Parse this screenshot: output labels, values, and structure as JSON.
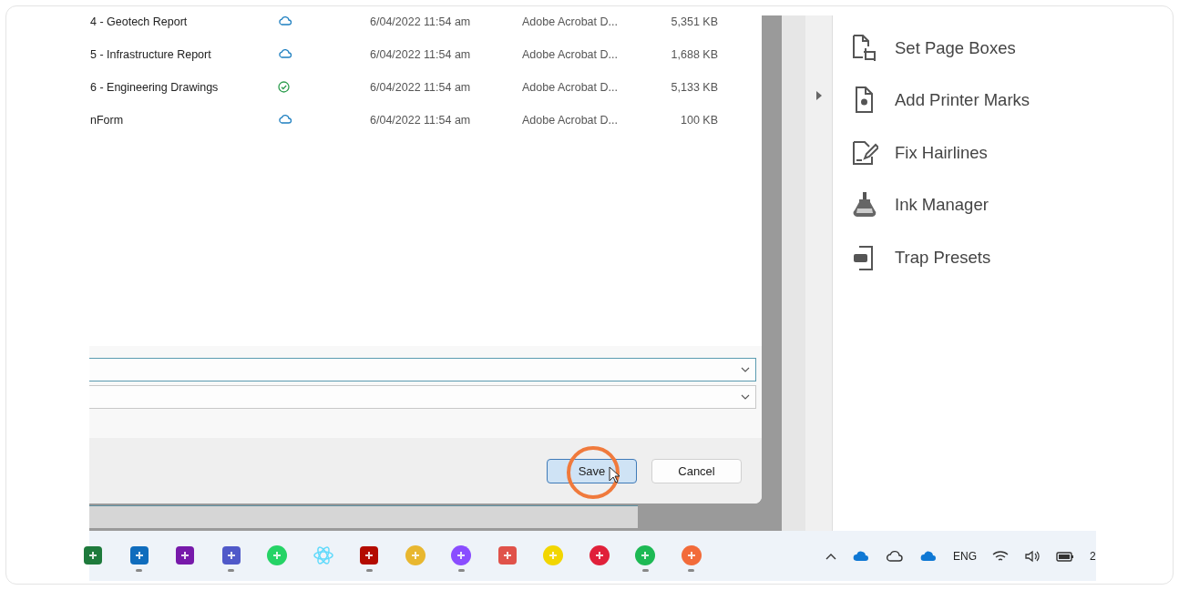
{
  "files": [
    {
      "name": "4 - Geotech Report",
      "synced": false,
      "modified": "6/04/2022 11:54 am",
      "type": "Adobe Acrobat D...",
      "size": "5,351 KB"
    },
    {
      "name": "5 - Infrastructure Report",
      "synced": false,
      "modified": "6/04/2022 11:54 am",
      "type": "Adobe Acrobat D...",
      "size": "1,688 KB"
    },
    {
      "name": "6 - Engineering Drawings",
      "synced": true,
      "modified": "6/04/2022 11:54 am",
      "type": "Adobe Acrobat D...",
      "size": "5,133 KB"
    },
    {
      "name": "nForm",
      "synced": false,
      "modified": "6/04/2022 11:54 am",
      "type": "Adobe Acrobat D...",
      "size": "100 KB"
    }
  ],
  "buttons": [
    {
      "label": "Save",
      "kind": "primary"
    },
    {
      "label": "Cancel",
      "kind": "secondary"
    }
  ],
  "tools": [
    {
      "label": "Set Page Boxes",
      "kind": "page-boxes"
    },
    {
      "label": "Add Printer Marks",
      "kind": "printer-marks"
    },
    {
      "label": "Fix Hairlines",
      "kind": "hairlines"
    },
    {
      "label": "Ink Manager",
      "kind": "ink"
    },
    {
      "label": "Trap Presets",
      "kind": "trap"
    }
  ],
  "taskbar": {
    "apps": [
      {
        "open": false
      },
      {
        "open": true
      },
      {
        "open": false
      },
      {
        "open": true
      },
      {
        "open": false
      },
      {
        "open": false
      },
      {
        "open": true
      },
      {
        "open": false
      },
      {
        "open": true
      },
      {
        "open": false
      },
      {
        "open": false
      },
      {
        "open": false
      },
      {
        "open": true
      },
      {
        "open": true
      }
    ],
    "language": "ENG",
    "clock": "2"
  }
}
